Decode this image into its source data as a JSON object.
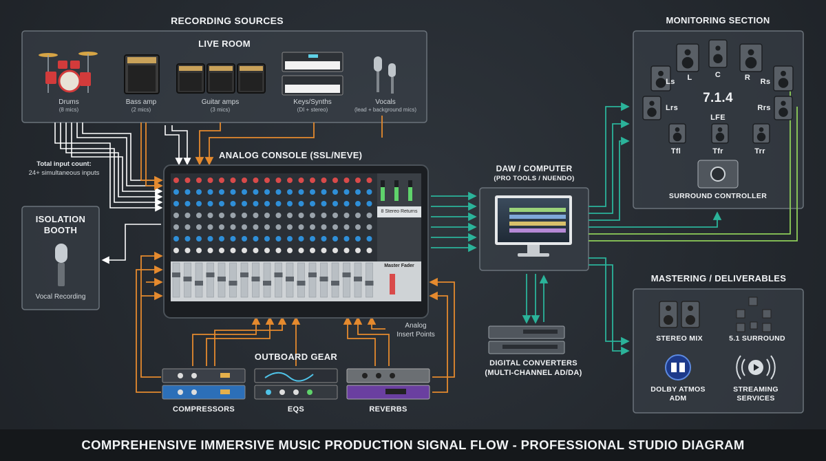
{
  "title": "COMPREHENSIVE IMMERSIVE MUSIC PRODUCTION SIGNAL FLOW - PROFESSIONAL STUDIO DIAGRAM",
  "recording_sources": {
    "heading": "RECORDING SOURCES",
    "live_room": "LIVE ROOM",
    "items": [
      {
        "name": "Drums",
        "detail": "(8 mics)"
      },
      {
        "name": "Bass amp",
        "detail": "(2 mics)"
      },
      {
        "name": "Guitar amps",
        "detail": "(3 mics)"
      },
      {
        "name": "Keys/Synths",
        "detail": "(DI + stereo)"
      },
      {
        "name": "Vocals",
        "detail": "(lead + background mics)"
      }
    ],
    "input_count_title": "Total input count:",
    "input_count_detail": "24+ simultaneous inputs"
  },
  "isolation_booth": {
    "heading_line1": "ISOLATION",
    "heading_line2": "BOOTH",
    "caption": "Vocal Recording"
  },
  "console": {
    "heading": "ANALOG CONSOLE (SSL/NEVE)",
    "stereo_returns": "8 Stereo Returns",
    "master_fader": "Master Fader"
  },
  "insert_points": {
    "line1": "Analog",
    "line2": "Insert Points"
  },
  "outboard": {
    "heading": "OUTBOARD GEAR",
    "compressors": "COMPRESSORS",
    "eqs": "EQS",
    "reverbs": "REVERBS"
  },
  "daw": {
    "heading": "DAW / COMPUTER",
    "sub": "(PRO TOOLS / NUENDO)"
  },
  "converters": {
    "line1": "DIGITAL CONVERTERS",
    "line2": "(MULTI-CHANNEL AD/DA)"
  },
  "monitoring": {
    "heading": "MONITORING SECTION",
    "format": "7.1.4",
    "speakers": {
      "ls": "Ls",
      "l": "L",
      "c": "C",
      "r": "R",
      "rs": "Rs",
      "lrs": "Lrs",
      "rrs": "Rrs",
      "lfe": "LFE",
      "tfl": "Tfl",
      "tfr": "Tfr",
      "trr": "Trr"
    },
    "controller": "SURROUND CONTROLLER"
  },
  "mastering": {
    "heading": "MASTERING / DELIVERABLES",
    "stereo": "STEREO MIX",
    "surround": "5.1 SURROUND",
    "atmos_line1": "DOLBY ATMOS",
    "atmos_line2": "ADM",
    "streaming_line1": "STREAMING",
    "streaming_line2": "SERVICES"
  },
  "colors": {
    "analog": "#e58a2e",
    "digital": "#2bb39a",
    "monitor": "#8fcf5a",
    "mic": "#ffffff",
    "panel_border": "#6b737b"
  }
}
